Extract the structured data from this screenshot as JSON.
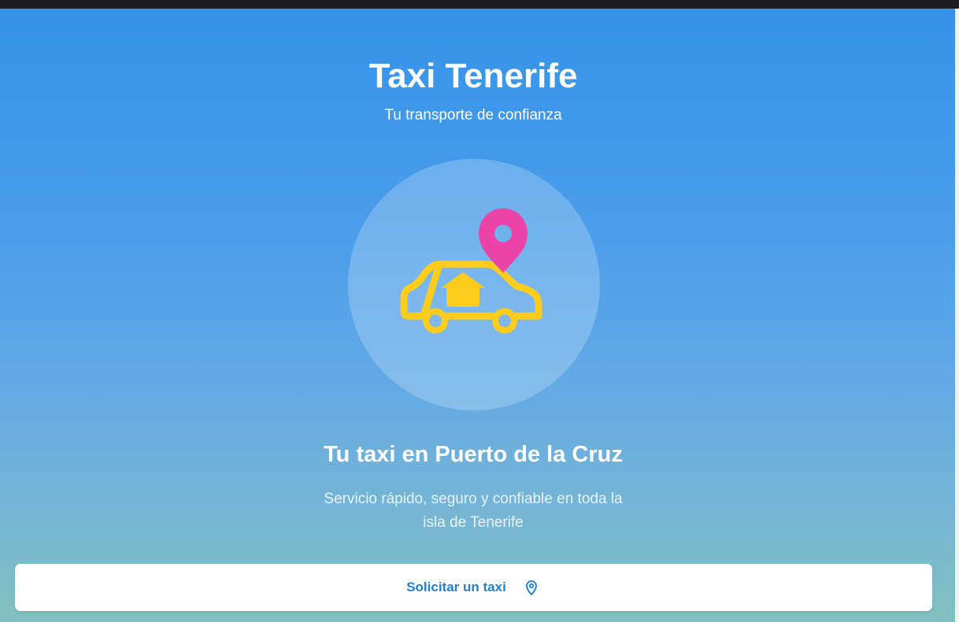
{
  "app": {
    "title": "Taxi Tenerife",
    "tagline": "Tu transporte de confianza"
  },
  "hero": {
    "illustration_icons": [
      "taxi-car-icon",
      "location-pin-icon",
      "house-icon"
    ],
    "headline": "Tu taxi en Puerto de la Cruz",
    "description": "Servicio rápido, seguro y confiable en toda la isla de Tenerife"
  },
  "cta": {
    "label": "Solicitar un taxi",
    "icon": "map-pin-icon"
  },
  "colors": {
    "gradient_top": "#3592e9",
    "gradient_bottom": "#83c1c0",
    "car_yellow": "#fdcc1c",
    "pin_pink": "#ec43a9",
    "cta_text": "#1f7fd3"
  }
}
